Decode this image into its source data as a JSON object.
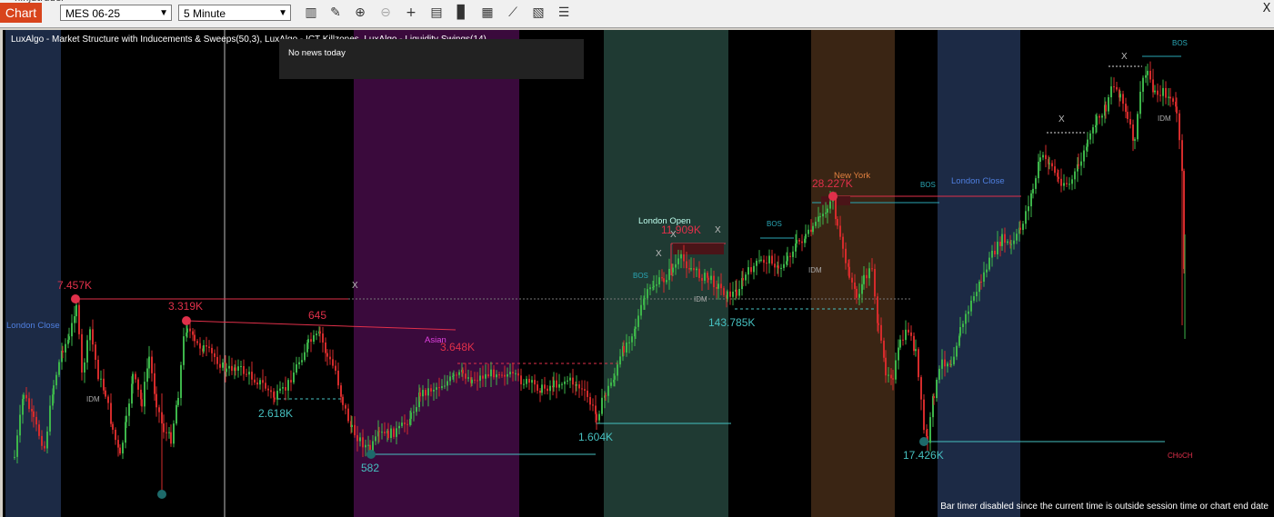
{
  "toolbar": {
    "title_fragment": "ninjatrader",
    "tab_label": "Chart",
    "instrument": "MES 06-25",
    "interval": "5 Minute",
    "icons": [
      "bar-type-icon",
      "pencil-icon",
      "zoom-in-icon",
      "zoom-out-icon",
      "crosshair-icon",
      "data-box-icon",
      "bar-style-icon",
      "chart-trader-icon",
      "strategies-icon",
      "properties-icon",
      "indicators-icon"
    ],
    "close": "X"
  },
  "chart": {
    "indicator_title": "LuxAlgo - Market Structure with Inducements & Sweeps(50,3), LuxAlgo - ICT Killzones, LuxAlgo - Liquidity Swings(14)",
    "news_text": "No news today",
    "bar_timer": "Bar timer disabled since the current time is outside session time or chart end date",
    "colors": {
      "bull": "#3db54a",
      "bear": "#d42b2b",
      "bos": "#2aa6b5",
      "swing_low": "#46c0c0",
      "swing_high": "#e0304a"
    },
    "sessions": [
      {
        "name": "London Close",
        "color": "#1c2a45",
        "label_color": "#4f7fe0"
      },
      {
        "name": "Asian",
        "color": "#3a0a3c",
        "label_color": "#e040e0"
      },
      {
        "name": "London Open",
        "color": "#1f3a33",
        "label_color": "#bfffef"
      },
      {
        "name": "New York",
        "color": "#3a2514",
        "label_color": "#e08040"
      },
      {
        "name": "London Close",
        "color": "#1c2a45",
        "label_color": "#4f7fe0"
      }
    ],
    "high_labels": [
      "7.457K",
      "3.319K",
      "645",
      "3.648K",
      "11.909K",
      "28.227K"
    ],
    "low_labels": [
      "2.618K",
      "582",
      "1.604K",
      "143.785K",
      "17.426K"
    ],
    "structure_labels": {
      "bos": "BOS",
      "idm": "IDM",
      "choch": "CHoCH",
      "sweep": "X"
    }
  }
}
